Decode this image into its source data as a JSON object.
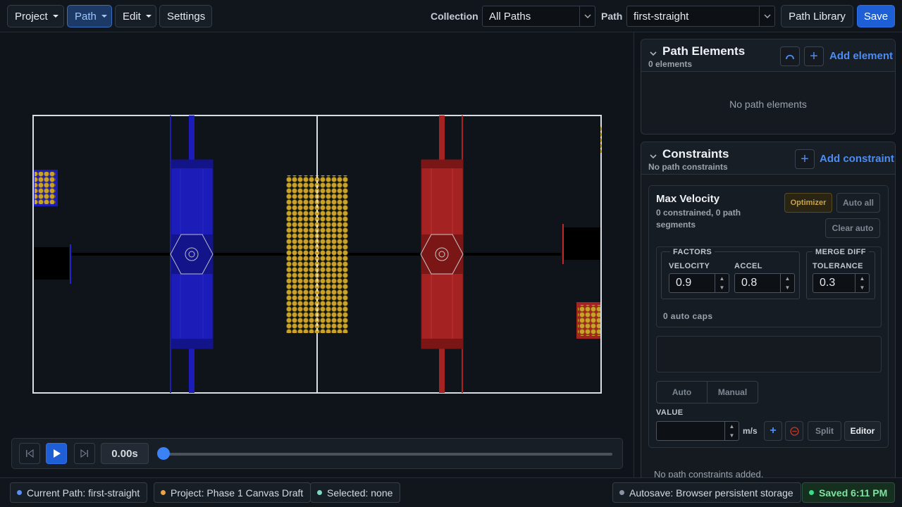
{
  "menu": {
    "project": "Project",
    "path": "Path",
    "edit": "Edit",
    "settings": "Settings"
  },
  "toolbar": {
    "collection_label": "Collection",
    "collection_value": "All Paths",
    "path_label": "Path",
    "path_value": "first-straight",
    "path_library": "Path Library",
    "save": "Save"
  },
  "playback": {
    "time": "0.00s",
    "progress": 0
  },
  "status": {
    "current_path": "Current Path: first-straight",
    "project": "Project: Phase 1 Canvas Draft",
    "selected": "Selected: none",
    "autosave": "Autosave: Browser persistent storage",
    "saved": "Saved 6:11 PM"
  },
  "path_elements": {
    "title": "Path Elements",
    "count": "0 elements",
    "add": "Add element",
    "empty": "No path elements"
  },
  "constraints": {
    "title": "Constraints",
    "subtitle": "No path constraints",
    "add": "Add constraint",
    "max_velocity": {
      "title": "Max Velocity",
      "subtitle": "0 constrained, 0 path segments",
      "optimizer": "Optimizer",
      "auto_all": "Auto all",
      "clear_auto": "Clear auto",
      "factors_label": "FACTORS",
      "velocity_label": "VELOCITY",
      "velocity_value": "0.9",
      "accel_label": "ACCEL",
      "accel_value": "0.8",
      "merge_label": "MERGE DIFF",
      "tolerance_label": "TOLERANCE",
      "tolerance_value": "0.3",
      "auto_caps": "0 auto caps",
      "mode_auto": "Auto",
      "mode_manual": "Manual",
      "value_label": "VALUE",
      "value": "",
      "unit": "m/s",
      "split": "Split",
      "editor": "Editor"
    },
    "empty": "No path constraints added."
  },
  "colors": {
    "accent": "#1f5fd6",
    "blue_alliance": "#1c1cb8",
    "red_alliance": "#a52222",
    "fuel": "#c9a227",
    "saved_green": "#3ddc84"
  }
}
